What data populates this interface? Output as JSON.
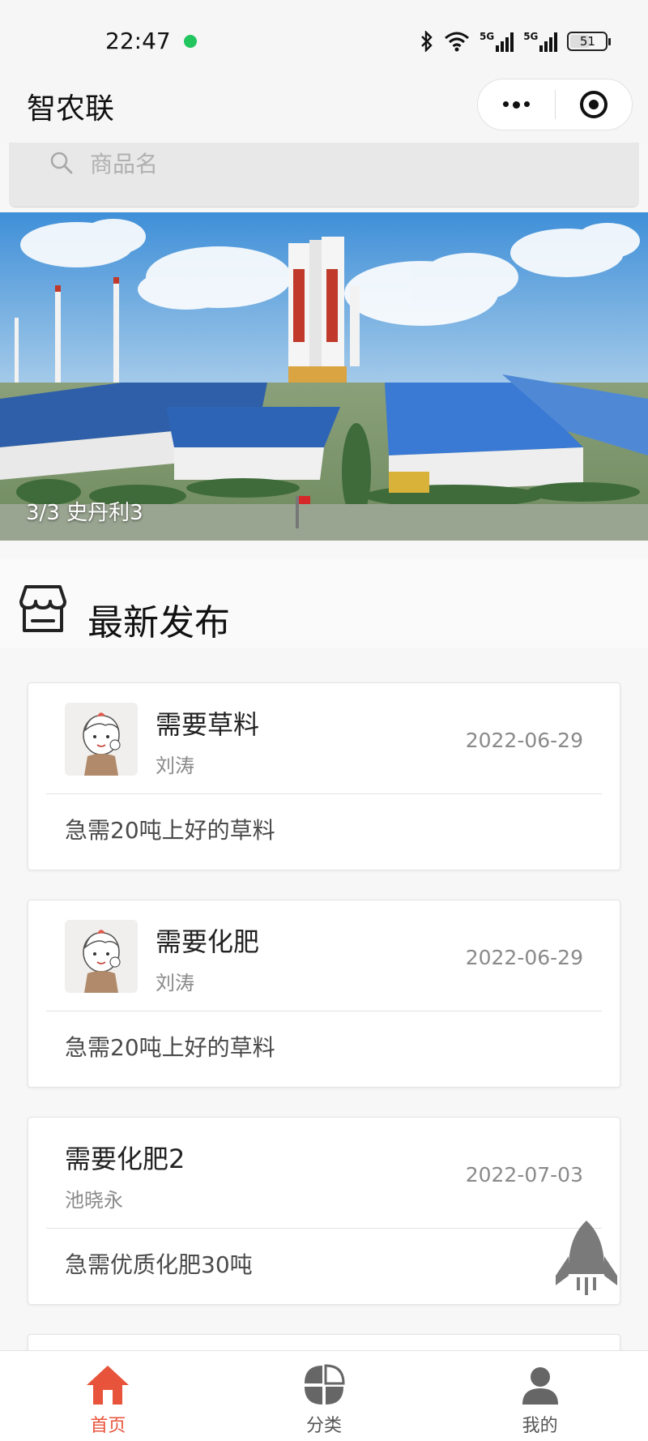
{
  "status_bar": {
    "time": "22:47",
    "network_1": "5G",
    "network_2": "5G",
    "battery": "51"
  },
  "nav": {
    "title": "智农联"
  },
  "search": {
    "placeholder": "商品名"
  },
  "banner": {
    "caption": "3/3 史丹利3"
  },
  "section": {
    "title": "最新发布"
  },
  "posts": [
    {
      "title": "需要草料",
      "author": "刘涛",
      "date": "2022-06-29",
      "description": "急需20吨上好的草料",
      "has_avatar": true
    },
    {
      "title": "需要化肥",
      "author": "刘涛",
      "date": "2022-06-29",
      "description": "急需20吨上好的草料",
      "has_avatar": true
    },
    {
      "title": "需要化肥2",
      "author": "池晓永",
      "date": "2022-07-03",
      "description": "急需优质化肥30吨",
      "has_avatar": false
    }
  ],
  "tabbar": {
    "items": [
      {
        "label": "首页",
        "icon": "home-icon",
        "active": true
      },
      {
        "label": "分类",
        "icon": "category-icon",
        "active": false
      },
      {
        "label": "我的",
        "icon": "user-icon",
        "active": false
      }
    ]
  },
  "colors": {
    "accent": "#e8543b",
    "status_dot": "#22c55e"
  }
}
